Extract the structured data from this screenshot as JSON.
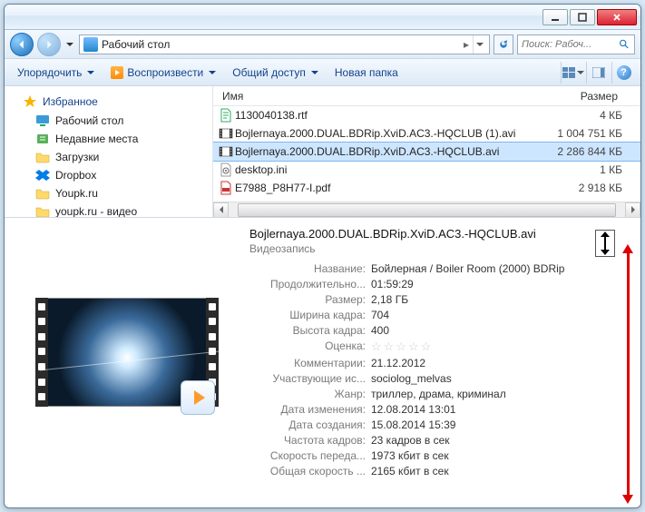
{
  "address": {
    "location": "Рабочий стол",
    "crumb_sep": "▸"
  },
  "search": {
    "placeholder": "Поиск: Рабоч..."
  },
  "toolbar": {
    "organize": "Упорядочить",
    "play": "Воспроизвести",
    "share": "Общий доступ",
    "newfolder": "Новая папка",
    "help": "?"
  },
  "sidebar": {
    "fav_header": "Избранное",
    "items": [
      {
        "label": "Рабочий стол"
      },
      {
        "label": "Недавние места"
      },
      {
        "label": "Загрузки"
      },
      {
        "label": "Dropbox"
      },
      {
        "label": "Youpk.ru"
      },
      {
        "label": "youpk.ru - видео"
      }
    ]
  },
  "columns": {
    "name": "Имя",
    "size": "Размер"
  },
  "files": [
    {
      "name": "1130040138.rtf",
      "size": "4 КБ",
      "type": "doc"
    },
    {
      "name": "Bojlernaya.2000.DUAL.BDRip.XviD.AC3.-HQCLUB (1).avi",
      "size": "1 004 751 КБ",
      "type": "video"
    },
    {
      "name": "Bojlernaya.2000.DUAL.BDRip.XviD.AC3.-HQCLUB.avi",
      "size": "2 286 844 КБ",
      "type": "video",
      "selected": true
    },
    {
      "name": "desktop.ini",
      "size": "1 КБ",
      "type": "ini"
    },
    {
      "name": "E7988_P8H77-I.pdf",
      "size": "2 918 КБ",
      "type": "pdf"
    }
  ],
  "details": {
    "title": "Bojlernaya.2000.DUAL.BDRip.XviD.AC3.-HQCLUB.avi",
    "type": "Видеозапись",
    "props": [
      {
        "k": "Название:",
        "v": "Бойлерная / Boiler Room (2000) BDRip"
      },
      {
        "k": "Продолжительно...",
        "v": "01:59:29"
      },
      {
        "k": "Размер:",
        "v": "2,18 ГБ"
      },
      {
        "k": "Ширина кадра:",
        "v": "704"
      },
      {
        "k": "Высота кадра:",
        "v": "400"
      },
      {
        "k": "Оценка:",
        "v": "☆☆☆☆☆",
        "stars": true
      },
      {
        "k": "Комментарии:",
        "v": "21.12.2012"
      },
      {
        "k": "Участвующие ис...",
        "v": "sociolog_melvas"
      },
      {
        "k": "Жанр:",
        "v": "триллер, драма, криминал"
      },
      {
        "k": "Дата изменения:",
        "v": "12.08.2014 13:01"
      },
      {
        "k": "Дата создания:",
        "v": "15.08.2014 15:39"
      },
      {
        "k": "Частота кадров:",
        "v": "23 кадров в сек"
      },
      {
        "k": "Скорость переда...",
        "v": "1973 кбит в сек"
      },
      {
        "k": "Общая скорость ...",
        "v": "2165 кбит в сек"
      }
    ]
  }
}
